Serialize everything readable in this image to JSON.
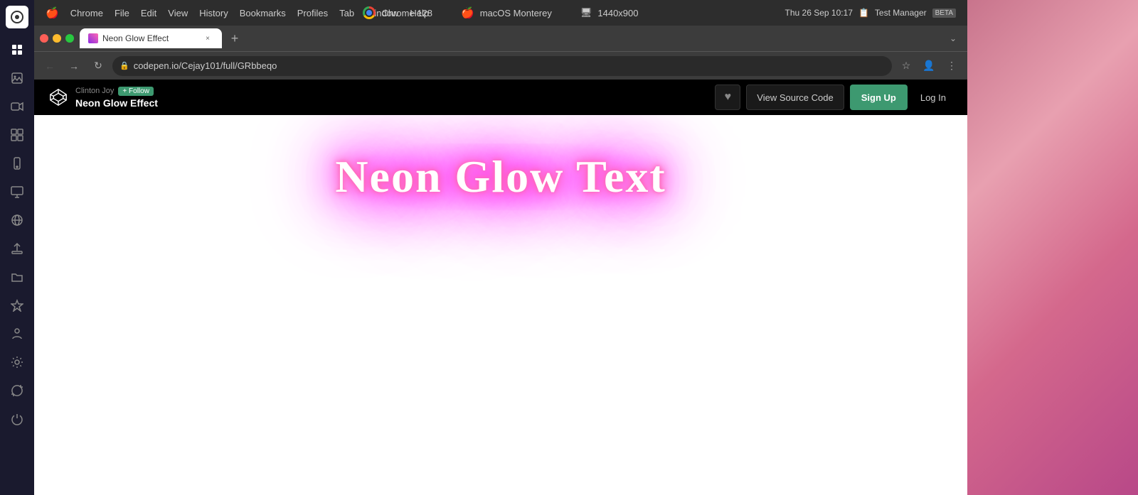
{
  "sidebar": {
    "logo": "◈",
    "icons": [
      {
        "name": "home-icon",
        "glyph": "⊞",
        "active": false
      },
      {
        "name": "image-icon",
        "glyph": "🖼",
        "active": false
      },
      {
        "name": "video-icon",
        "glyph": "▶",
        "active": false
      },
      {
        "name": "grid-icon",
        "glyph": "⊞",
        "active": false
      },
      {
        "name": "phone-icon",
        "glyph": "📱",
        "active": false
      },
      {
        "name": "monitor-icon",
        "glyph": "🖥",
        "active": false
      },
      {
        "name": "globe-icon",
        "glyph": "🌐",
        "active": false
      },
      {
        "name": "upload-icon",
        "glyph": "⬆",
        "active": false
      },
      {
        "name": "folder-icon",
        "glyph": "📁",
        "active": false
      },
      {
        "name": "star-icon",
        "glyph": "✦",
        "active": false
      },
      {
        "name": "person-icon",
        "glyph": "🚶",
        "active": false
      },
      {
        "name": "settings-icon",
        "glyph": "⚙",
        "active": false
      },
      {
        "name": "refresh-icon",
        "glyph": "↻",
        "active": false
      },
      {
        "name": "power-icon",
        "glyph": "⏻",
        "active": false
      }
    ]
  },
  "os_topbar": {
    "browser_name": "Chrome 128",
    "os_name": "macOS Monterey",
    "resolution": "1440x900",
    "datetime": "Thu 26 Sep  10:17",
    "test_manager": "Test Manager",
    "beta_label": "BETA"
  },
  "chrome": {
    "tab": {
      "title": "Neon Glow Effect",
      "favicon": "codepen"
    },
    "address": "codepen.io/Cejay101/full/GRbbeqo"
  },
  "codepen": {
    "author": "Clinton Joy",
    "follow_label": "+ Follow",
    "pen_title": "Neon Glow Effect",
    "heart_icon": "♥",
    "view_source_label": "View Source Code",
    "signup_label": "Sign Up",
    "login_label": "Log In",
    "neon_text": "Neon Glow Text"
  },
  "menus": {
    "apple": "⌘",
    "items": [
      "Chrome",
      "File",
      "Edit",
      "View",
      "History",
      "Bookmarks",
      "Profiles",
      "Tab",
      "Window",
      "Help"
    ]
  }
}
